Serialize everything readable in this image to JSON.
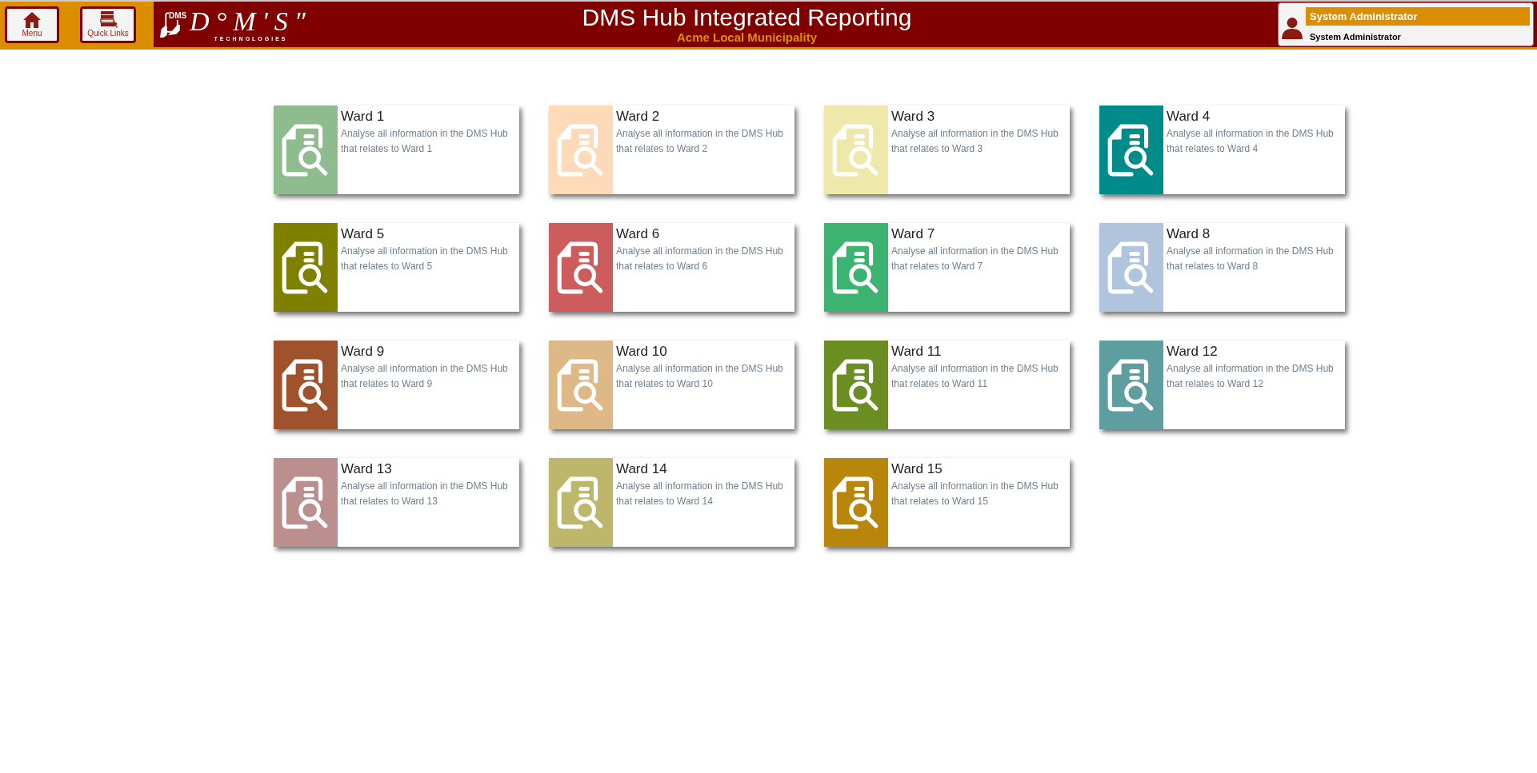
{
  "header": {
    "buttons": [
      {
        "kind": "home",
        "label": "Menu"
      },
      {
        "kind": "links",
        "label": "Quick Links"
      }
    ],
    "logo": {
      "wordmark": "D°M'S″",
      "tagline": "TECHNOLOGIES",
      "screen_text": "DMS"
    },
    "title": "DMS Hub Integrated Reporting",
    "subtitle": "Acme Local Municipality",
    "user": {
      "name": "System Administrator",
      "role": "System Administrator"
    }
  },
  "cards": [
    {
      "title": "Ward 1",
      "description": "Analyse all information in the DMS Hub that relates to Ward 1",
      "color": "#8fbc8f"
    },
    {
      "title": "Ward 2",
      "description": "Analyse all information in the DMS Hub that relates to Ward 2",
      "color": "#ffdab9"
    },
    {
      "title": "Ward 3",
      "description": "Analyse all information in the DMS Hub that relates to Ward 3",
      "color": "#eee8aa"
    },
    {
      "title": "Ward 4",
      "description": "Analyse all information in the DMS Hub that relates to Ward 4",
      "color": "#008b8b"
    },
    {
      "title": "Ward 5",
      "description": "Analyse all information in the DMS Hub that relates to Ward 5",
      "color": "#808000"
    },
    {
      "title": "Ward 6",
      "description": "Analyse all information in the DMS Hub that relates to Ward 6",
      "color": "#cd5c5c"
    },
    {
      "title": "Ward 7",
      "description": "Analyse all information in the DMS Hub that relates to Ward 7",
      "color": "#3cb371"
    },
    {
      "title": "Ward 8",
      "description": "Analyse all information in the DMS Hub that relates to Ward 8",
      "color": "#b0c4de"
    },
    {
      "title": "Ward 9",
      "description": "Analyse all information in the DMS Hub that relates to Ward 9",
      "color": "#a0522d"
    },
    {
      "title": "Ward 10",
      "description": "Analyse all information in the DMS Hub that relates to Ward 10",
      "color": "#deb887"
    },
    {
      "title": "Ward 11",
      "description": "Analyse all information in the DMS Hub that relates to Ward 11",
      "color": "#6b8e23"
    },
    {
      "title": "Ward 12",
      "description": "Analyse all information in the DMS Hub that relates to Ward 12",
      "color": "#5f9ea0"
    },
    {
      "title": "Ward 13",
      "description": "Analyse all information in the DMS Hub that relates to Ward 13",
      "color": "#bc8f8f"
    },
    {
      "title": "Ward 14",
      "description": "Analyse all information in the DMS Hub that relates to Ward 14",
      "color": "#bdb76b"
    },
    {
      "title": "Ward 15",
      "description": "Analyse all information in the DMS Hub that relates to Ward 15",
      "color": "#b8860b"
    }
  ]
}
